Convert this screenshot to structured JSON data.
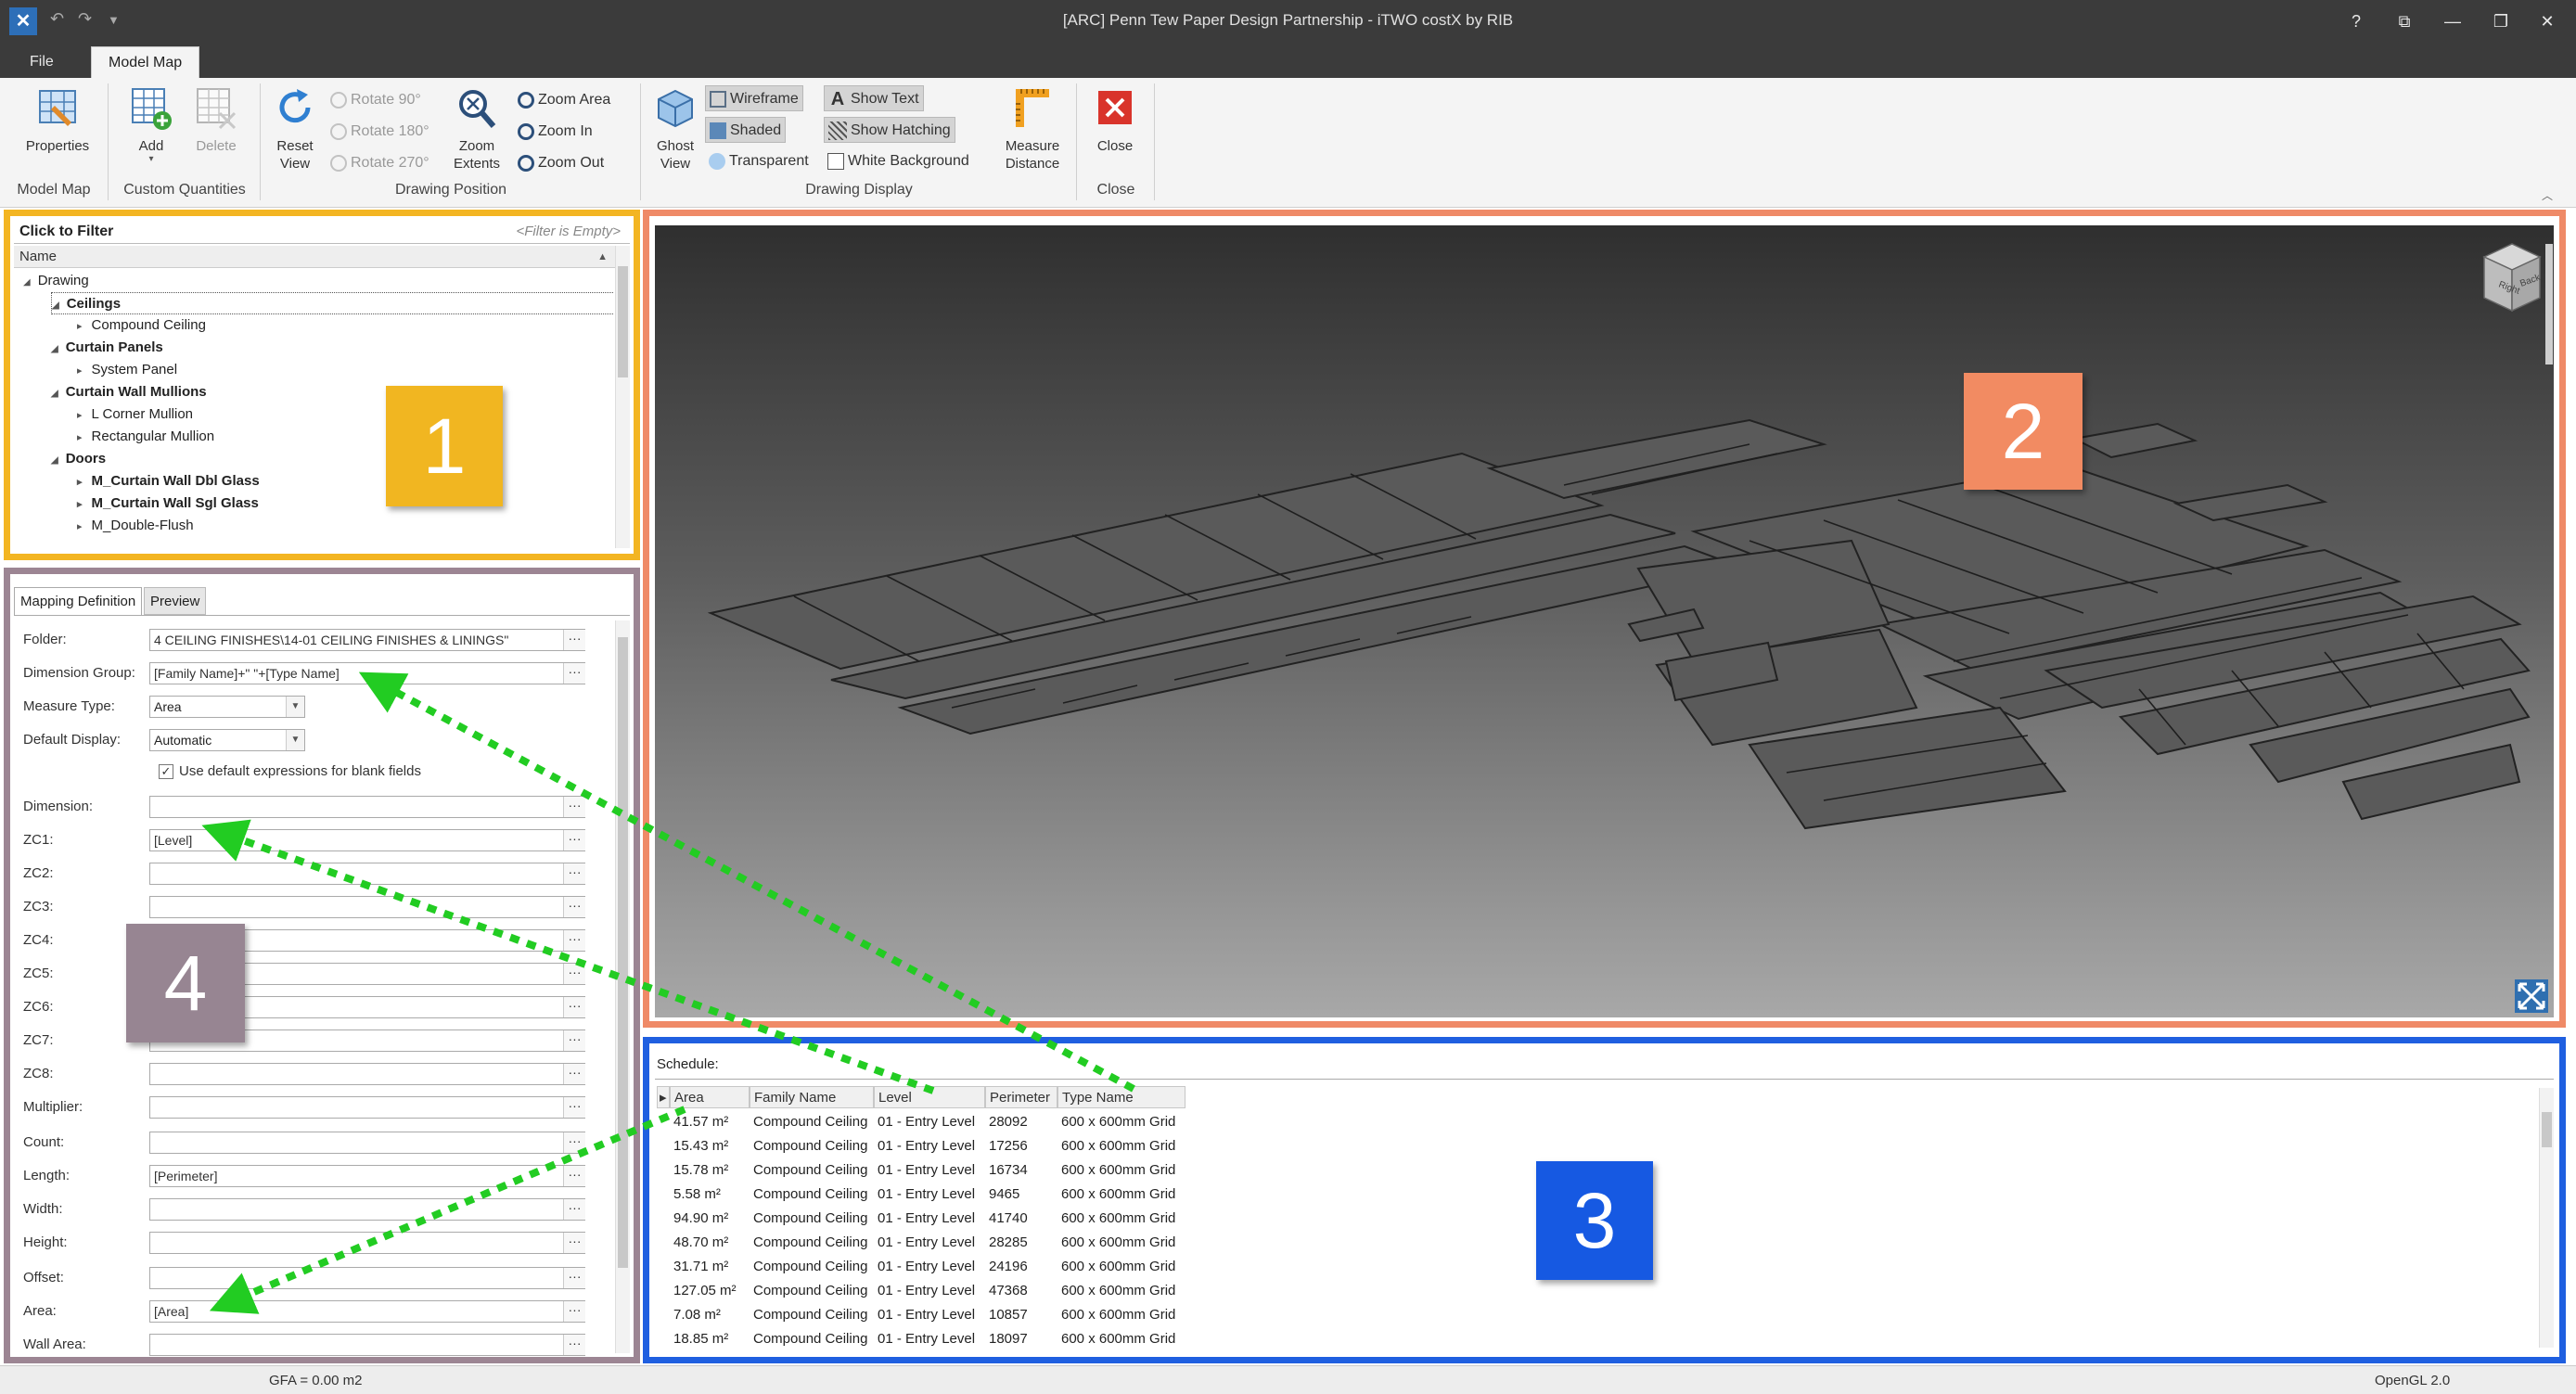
{
  "app": {
    "window_title": "[ARC] Penn Tew Paper Design Partnership - iTWO costX by RIB",
    "window_buttons": [
      "?",
      "⧉",
      "—",
      "❐",
      "✕"
    ]
  },
  "tabs": [
    {
      "label": "File"
    },
    {
      "label": "Model Map"
    }
  ],
  "ribbon": {
    "groups": [
      {
        "label": "Model Map"
      },
      {
        "label": "Custom Quantities"
      },
      {
        "label": "Drawing Position"
      },
      {
        "label": "Drawing Display"
      },
      {
        "label": "Close"
      }
    ],
    "properties": "Properties",
    "add": "Add",
    "delete": "Delete",
    "reset_view": [
      "Reset",
      "View"
    ],
    "rotate90": "Rotate 90°",
    "rotate180": "Rotate 180°",
    "rotate270": "Rotate 270°",
    "zoom_extents": [
      "Zoom",
      "Extents"
    ],
    "zoom_area": "Zoom Area",
    "zoom_in": "Zoom In",
    "zoom_out": "Zoom Out",
    "ghost_view": [
      "Ghost",
      "View"
    ],
    "wireframe": "Wireframe",
    "shaded": "Shaded",
    "transparent": "Transparent",
    "show_text": "Show Text",
    "show_hatching": "Show Hatching",
    "white_background": "White Background",
    "measure_distance": [
      "Measure",
      "Distance"
    ],
    "close": "Close"
  },
  "filter": {
    "label": "Click to Filter",
    "hint": "<Filter is Empty>",
    "column": "Name"
  },
  "tree": [
    {
      "label": "Drawing",
      "bold": false,
      "prefix": "◢"
    },
    {
      "label": "Ceilings",
      "bold": true,
      "prefix": "◢"
    },
    {
      "label": "Compound Ceiling",
      "bold": false,
      "prefix": "▸"
    },
    {
      "label": "Curtain Panels",
      "bold": true,
      "prefix": "◢"
    },
    {
      "label": "System Panel",
      "bold": false,
      "prefix": "▸"
    },
    {
      "label": "Curtain Wall Mullions",
      "bold": true,
      "prefix": "◢"
    },
    {
      "label": "L Corner Mullion",
      "bold": false,
      "prefix": "▸"
    },
    {
      "label": "Rectangular Mullion",
      "bold": false,
      "prefix": "▸"
    },
    {
      "label": "Doors",
      "bold": true,
      "prefix": "◢"
    },
    {
      "label": "M_Curtain Wall Dbl Glass",
      "bold": true,
      "prefix": "▸"
    },
    {
      "label": "M_Curtain Wall Sgl Glass",
      "bold": true,
      "prefix": "▸"
    },
    {
      "label": "M_Double-Flush",
      "bold": false,
      "prefix": "▸"
    }
  ],
  "mapping": {
    "tab_definition": "Mapping Definition",
    "tab_preview": "Preview",
    "checkbox_label": "Use default expressions for blank fields",
    "fields": [
      {
        "label": "Folder:",
        "value": "4 CEILING FINISHES\\14-01 CEILING FINISHES & LININGS\"",
        "kind": "text"
      },
      {
        "label": "Dimension Group:",
        "value": "[Family Name]+\" \"+[Type Name]",
        "kind": "text"
      },
      {
        "label": "Measure Type:",
        "value": "Area",
        "kind": "dropdown"
      },
      {
        "label": "Default Display:",
        "value": "Automatic",
        "kind": "dropdown"
      },
      {
        "label": "Dimension:",
        "value": "",
        "kind": "text"
      },
      {
        "label": "ZC1:",
        "value": "[Level]",
        "kind": "text"
      },
      {
        "label": "ZC2:",
        "value": "",
        "kind": "text"
      },
      {
        "label": "ZC3:",
        "value": "",
        "kind": "text"
      },
      {
        "label": "ZC4:",
        "value": "",
        "kind": "text"
      },
      {
        "label": "ZC5:",
        "value": "",
        "kind": "text"
      },
      {
        "label": "ZC6:",
        "value": "",
        "kind": "text"
      },
      {
        "label": "ZC7:",
        "value": "",
        "kind": "text"
      },
      {
        "label": "ZC8:",
        "value": "",
        "kind": "text"
      },
      {
        "label": "Multiplier:",
        "value": "",
        "kind": "text"
      },
      {
        "label": "Count:",
        "value": "",
        "kind": "text"
      },
      {
        "label": "Length:",
        "value": "[Perimeter]",
        "kind": "text"
      },
      {
        "label": "Width:",
        "value": "",
        "kind": "text"
      },
      {
        "label": "Height:",
        "value": "",
        "kind": "text"
      },
      {
        "label": "Offset:",
        "value": "",
        "kind": "text"
      },
      {
        "label": "Area:",
        "value": "[Area]",
        "kind": "text"
      },
      {
        "label": "Wall Area:",
        "value": "",
        "kind": "text"
      }
    ]
  },
  "viewcube": {
    "right": "Right",
    "back": "Back"
  },
  "schedule": {
    "label": "Schedule:",
    "columns": [
      "Area",
      "Family Name",
      "Level",
      "Perimeter",
      "Type Name"
    ],
    "rows": [
      [
        "41.57 m²",
        "Compound Ceiling",
        "01 - Entry Level",
        "28092",
        "600 x 600mm Grid"
      ],
      [
        "15.43 m²",
        "Compound Ceiling",
        "01 - Entry Level",
        "17256",
        "600 x 600mm Grid"
      ],
      [
        "15.78 m²",
        "Compound Ceiling",
        "01 - Entry Level",
        "16734",
        "600 x 600mm Grid"
      ],
      [
        "5.58 m²",
        "Compound Ceiling",
        "01 - Entry Level",
        "9465",
        "600 x 600mm Grid"
      ],
      [
        "94.90 m²",
        "Compound Ceiling",
        "01 - Entry Level",
        "41740",
        "600 x 600mm Grid"
      ],
      [
        "48.70 m²",
        "Compound Ceiling",
        "01 - Entry Level",
        "28285",
        "600 x 600mm Grid"
      ],
      [
        "31.71 m²",
        "Compound Ceiling",
        "01 - Entry Level",
        "24196",
        "600 x 600mm Grid"
      ],
      [
        "127.05 m²",
        "Compound Ceiling",
        "01 - Entry Level",
        "47368",
        "600 x 600mm Grid"
      ],
      [
        "7.08 m²",
        "Compound Ceiling",
        "01 - Entry Level",
        "10857",
        "600 x 600mm Grid"
      ],
      [
        "18.85 m²",
        "Compound Ceiling",
        "01 - Entry Level",
        "18097",
        "600 x 600mm Grid"
      ]
    ]
  },
  "callouts": [
    "1",
    "2",
    "3",
    "4"
  ],
  "colors": {
    "panel1": "#f3b522",
    "panel2": "#ef8a67",
    "panel3": "#1f5fe0",
    "panel4": "#9c8593",
    "arrows": "#22cc22"
  },
  "status": {
    "gfa": "GFA = 0.00 m2",
    "renderer": "OpenGL 2.0"
  }
}
